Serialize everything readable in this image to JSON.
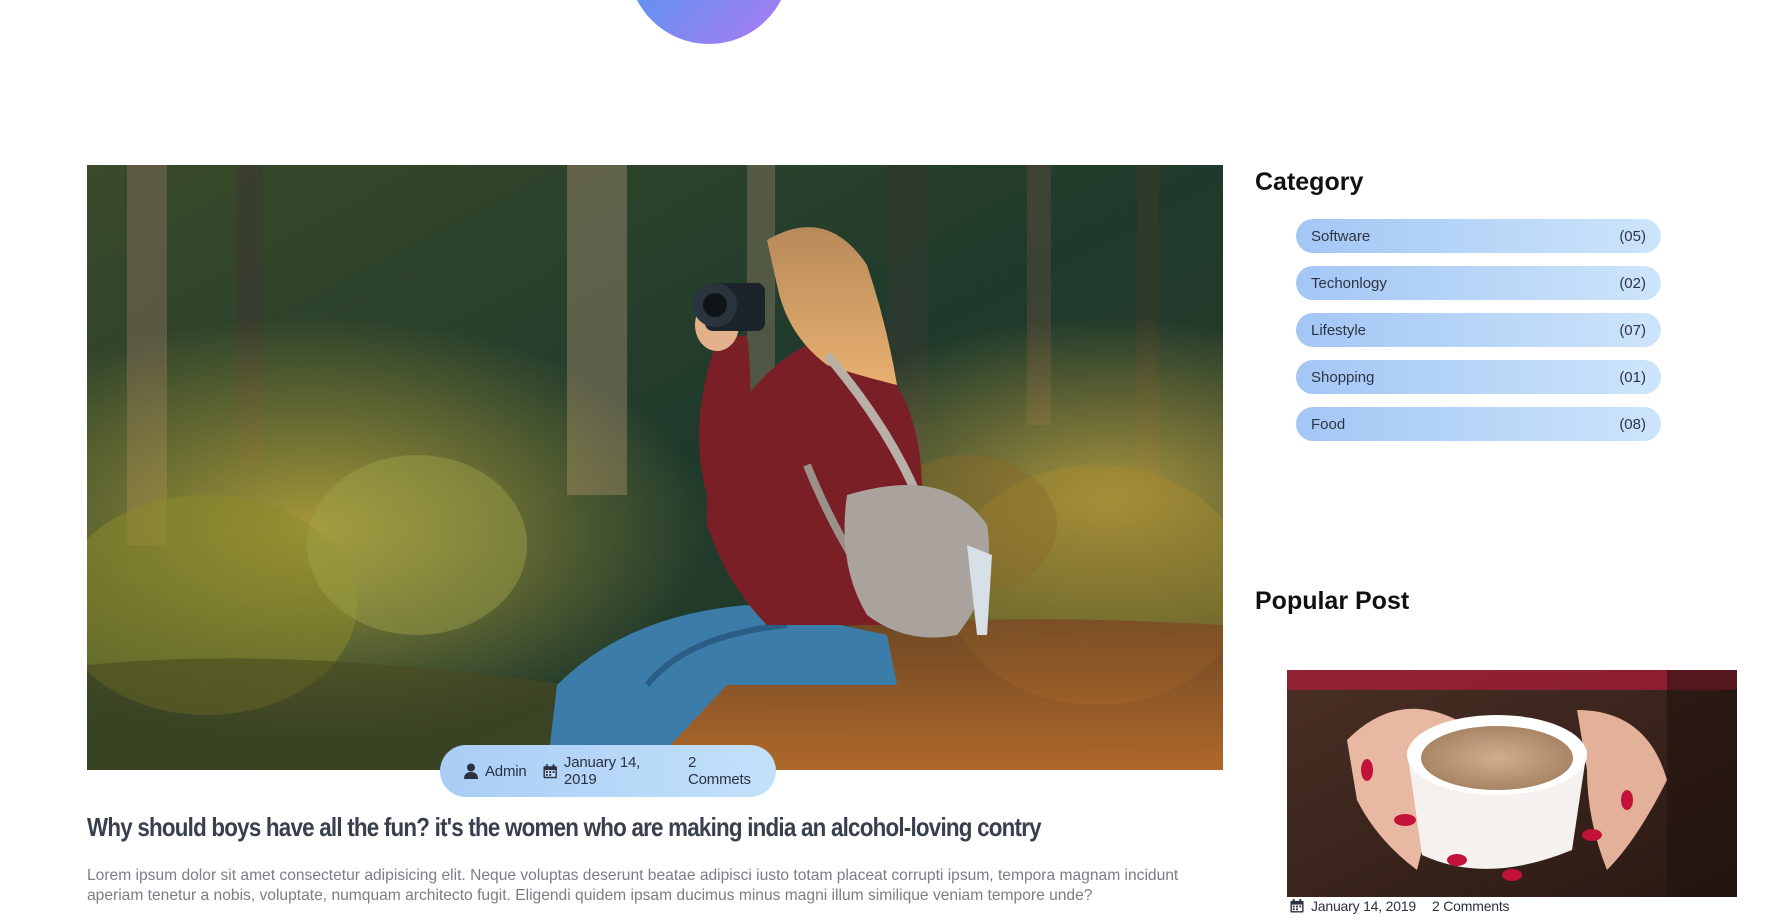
{
  "post": {
    "author": "Admin",
    "date": "January 14, 2019",
    "comments": "2 Commets",
    "title": "Why should boys have all the fun? it's the women who are making india an alcohol-loving contry",
    "excerpt": "Lorem ipsum dolor sit amet consectetur adipisicing elit. Neque voluptas deserunt beatae adipisci iusto totam placeat corrupti ipsum, tempora magnam incidunt aperiam tenetur a nobis, voluptate, numquam architecto fugit. Eligendi quidem ipsam ducimus minus magni illum similique veniam tempore unde?"
  },
  "sidebar": {
    "category_title": "Category",
    "categories": [
      {
        "name": "Software",
        "count": "(05)"
      },
      {
        "name": "Techonlogy",
        "count": "(02)"
      },
      {
        "name": "Lifestyle",
        "count": "(07)"
      },
      {
        "name": "Shopping",
        "count": "(01)"
      },
      {
        "name": "Food",
        "count": "(08)"
      }
    ],
    "popular_title": "Popular Post",
    "popular": {
      "date": "January 14, 2019",
      "comments": "2 Comments"
    }
  },
  "icons": {
    "author": "user-icon",
    "date": "calendar-icon"
  },
  "colors": {
    "pill_start": "#a9cdf6",
    "pill_end": "#c3e1fa",
    "title": "#3a3f4e",
    "excerpt": "#7a7d86",
    "circle_start": "#3aa6e8",
    "circle_end": "#b07af2"
  }
}
